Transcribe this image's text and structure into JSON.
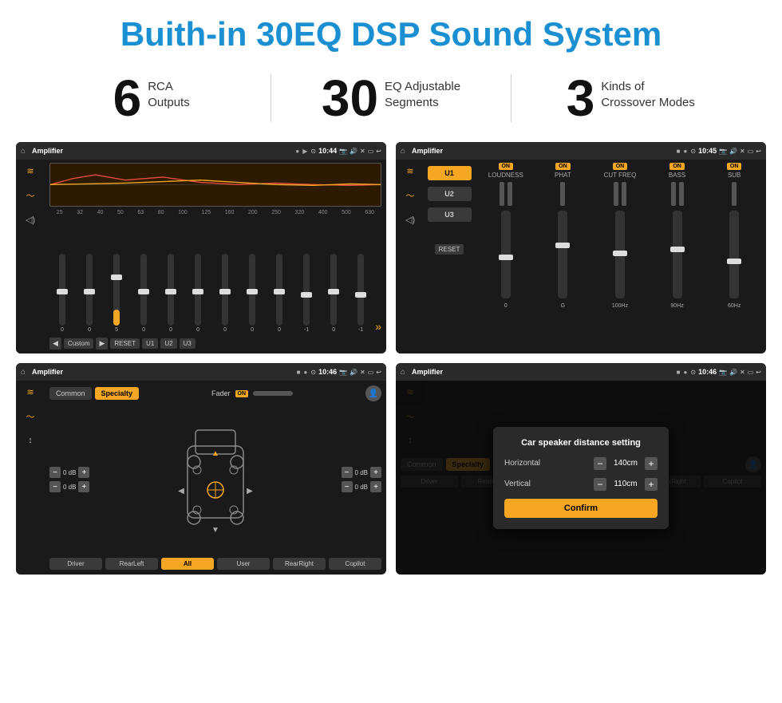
{
  "page": {
    "title": "Buith-in 30EQ DSP Sound System",
    "stats": [
      {
        "number": "6",
        "text": "RCA\nOutputs"
      },
      {
        "number": "30",
        "text": "EQ Adjustable\nSegments"
      },
      {
        "number": "3",
        "text": "Kinds of\nCrossover Modes"
      }
    ]
  },
  "screens": {
    "eq": {
      "status_title": "Amplifier",
      "time": "10:44",
      "freq_labels": [
        "25",
        "32",
        "40",
        "50",
        "63",
        "80",
        "100",
        "125",
        "160",
        "200",
        "250",
        "320",
        "400",
        "500",
        "630"
      ],
      "slider_values": [
        "0",
        "0",
        "0",
        "5",
        "0",
        "0",
        "0",
        "0",
        "0",
        "-1",
        "0",
        "-1"
      ],
      "preset": "Custom",
      "buttons": [
        "◀",
        "Custom",
        "▶",
        "RESET",
        "U1",
        "U2",
        "U3"
      ]
    },
    "crossover": {
      "status_title": "Amplifier",
      "time": "10:45",
      "u_buttons": [
        "U1",
        "U2",
        "U3"
      ],
      "channels": [
        "LOUDNESS",
        "PHAT",
        "CUT FREQ",
        "BASS",
        "SUB"
      ],
      "channel_on": [
        true,
        true,
        true,
        true,
        true
      ],
      "reset_label": "RESET"
    },
    "speaker": {
      "status_title": "Amplifier",
      "time": "10:46",
      "tabs": [
        "Common",
        "Specialty"
      ],
      "active_tab": "Specialty",
      "fader_label": "Fader",
      "fader_on": "ON",
      "db_values": [
        "0 dB",
        "0 dB",
        "0 dB",
        "0 dB"
      ],
      "bottom_btns": [
        "Driver",
        "RearLeft",
        "All",
        "User",
        "RearRight",
        "Copilot"
      ]
    },
    "dialog": {
      "status_title": "Amplifier",
      "time": "10:46",
      "tabs": [
        "Common",
        "Specialty"
      ],
      "dialog_title": "Car speaker distance setting",
      "horizontal_label": "Horizontal",
      "horizontal_value": "140cm",
      "vertical_label": "Vertical",
      "vertical_value": "110cm",
      "confirm_label": "Confirm",
      "bottom_btns": [
        "Driver",
        "RearLeft",
        "All",
        "User",
        "RearRight",
        "Copilot"
      ]
    }
  },
  "icons": {
    "home": "⌂",
    "dot": "●",
    "play": "▶",
    "back": "↩",
    "location": "⊙",
    "speaker_on": "🔊",
    "x": "✕",
    "rect": "▭",
    "eq_icon": "≡",
    "wave": "〜",
    "vol": "◁",
    "minus": "−",
    "plus": "+"
  }
}
